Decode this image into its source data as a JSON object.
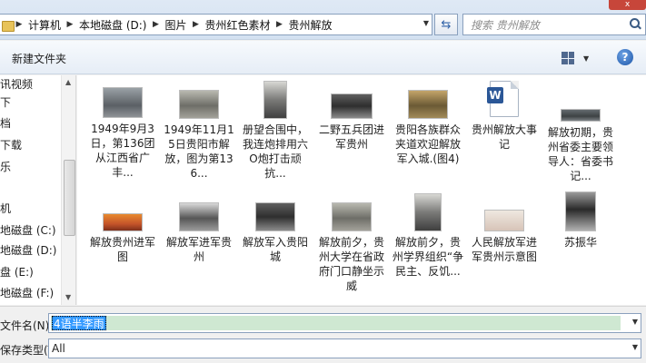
{
  "window": {
    "close_label": "x"
  },
  "breadcrumbs": [
    "计算机",
    "本地磁盘 (D:)",
    "图片",
    "贵州红色素材",
    "贵州解放"
  ],
  "search": {
    "placeholder": "搜索 贵州解放"
  },
  "toolbar": {
    "new_folder_label": "新建文件夹",
    "help_label": "?"
  },
  "sidebar": {
    "items": [
      {
        "label": "讯视频"
      },
      {
        "label": "下"
      },
      {
        "label": "档"
      },
      {
        "label": "下载"
      },
      {
        "label": "乐"
      },
      {
        "label": "机"
      },
      {
        "label": "地磁盘 (C:)"
      },
      {
        "label": "地磁盘 (D:)"
      },
      {
        "label": "盘 (E:)"
      },
      {
        "label": "地磁盘 (F:)"
      }
    ]
  },
  "files": [
    {
      "name": "1949年9月3日，第136团从江西省广丰...",
      "thumb": "photo",
      "style": "ph-a"
    },
    {
      "name": "1949年11月15日贵阳市解放，图为第136...",
      "thumb": "photo",
      "style": "ph-b"
    },
    {
      "name": "册望合围中，我连炮排用六O炮打击顽抗...",
      "thumb": "photo",
      "style": "ph-c"
    },
    {
      "name": "二野五兵团进军贵州",
      "thumb": "photo",
      "style": "ph-d"
    },
    {
      "name": "贵阳各族群众夹道欢迎解放军入城.(图4)",
      "thumb": "photo",
      "style": "ph-e"
    },
    {
      "name": "贵州解放大事记",
      "thumb": "word-doc",
      "style": ""
    },
    {
      "name": "解放初期，贵州省委主要领导人：省委书记...",
      "thumb": "photo",
      "style": "ph-j"
    },
    {
      "name": "解放贵州进军图",
      "thumb": "photo",
      "style": "ph-f"
    },
    {
      "name": "解放军进军贵州",
      "thumb": "photo",
      "style": "ph-g"
    },
    {
      "name": "解放军入贵阳城",
      "thumb": "photo",
      "style": "ph-d"
    },
    {
      "name": "解放前夕，贵州大学在省政府门口静坐示威",
      "thumb": "photo",
      "style": "ph-b"
    },
    {
      "name": "解放前夕，贵州学界组织“争民主、反饥...",
      "thumb": "photo",
      "style": "ph-c"
    },
    {
      "name": "人民解放军进军贵州示意图",
      "thumb": "photo",
      "style": "ph-h"
    },
    {
      "name": "苏振华",
      "thumb": "photo",
      "style": "ph-i"
    }
  ],
  "filename": {
    "label": "文件名(N):",
    "value": "4语半李雨"
  },
  "filetype": {
    "label": "保存类型(T):",
    "value": "All"
  }
}
